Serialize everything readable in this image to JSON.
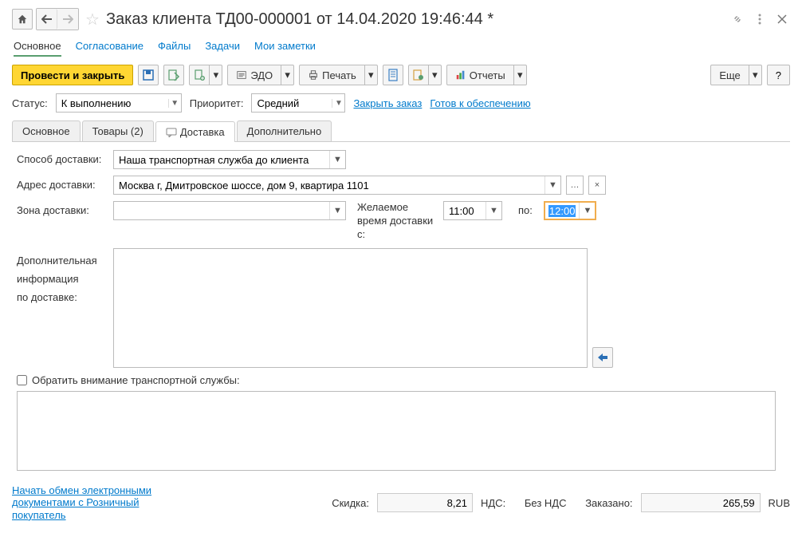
{
  "header": {
    "title": "Заказ клиента ТД00-000001 от 14.04.2020 19:46:44 *"
  },
  "navtabs": {
    "main": "Основное",
    "approval": "Согласование",
    "files": "Файлы",
    "tasks": "Задачи",
    "notes": "Мои заметки"
  },
  "toolbar": {
    "post_and_close": "Провести и закрыть",
    "edo": "ЭДО",
    "print": "Печать",
    "reports": "Отчеты",
    "more": "Еще",
    "help": "?"
  },
  "status_row": {
    "status_label": "Статус:",
    "status_value": "К выполнению",
    "priority_label": "Приоритет:",
    "priority_value": "Средний",
    "close_order": "Закрыть заказ",
    "ready_for_supply": "Готов к обеспечению"
  },
  "inner_tabs": {
    "main": "Основное",
    "goods": "Товары (2)",
    "delivery": "Доставка",
    "additional": "Дополнительно"
  },
  "delivery": {
    "method_label": "Способ доставки:",
    "method_value": "Наша транспортная служба до клиента",
    "address_label": "Адрес доставки:",
    "address_value": "Москва г, Дмитровское шоссе, дом 9, квартира 1101",
    "zone_label": "Зона доставки:",
    "zone_value": "",
    "time_label": "Желаемое время доставки с:",
    "time_from": "11:00",
    "time_to_label": "по:",
    "time_to": "12:00",
    "extra_info_label1": "Дополнительная",
    "extra_info_label2": "информация",
    "extra_info_label3": "по доставке:",
    "attention_label": "Обратить внимание транспортной службы:"
  },
  "footer": {
    "link": "Начать обмен электронными документами с Розничный покупатель",
    "discount_label": "Скидка:",
    "discount_value": "8,21",
    "vat_label": "НДС:",
    "vat_value": "Без НДС",
    "ordered_label": "Заказано:",
    "ordered_value": "265,59",
    "currency": "RUB"
  }
}
